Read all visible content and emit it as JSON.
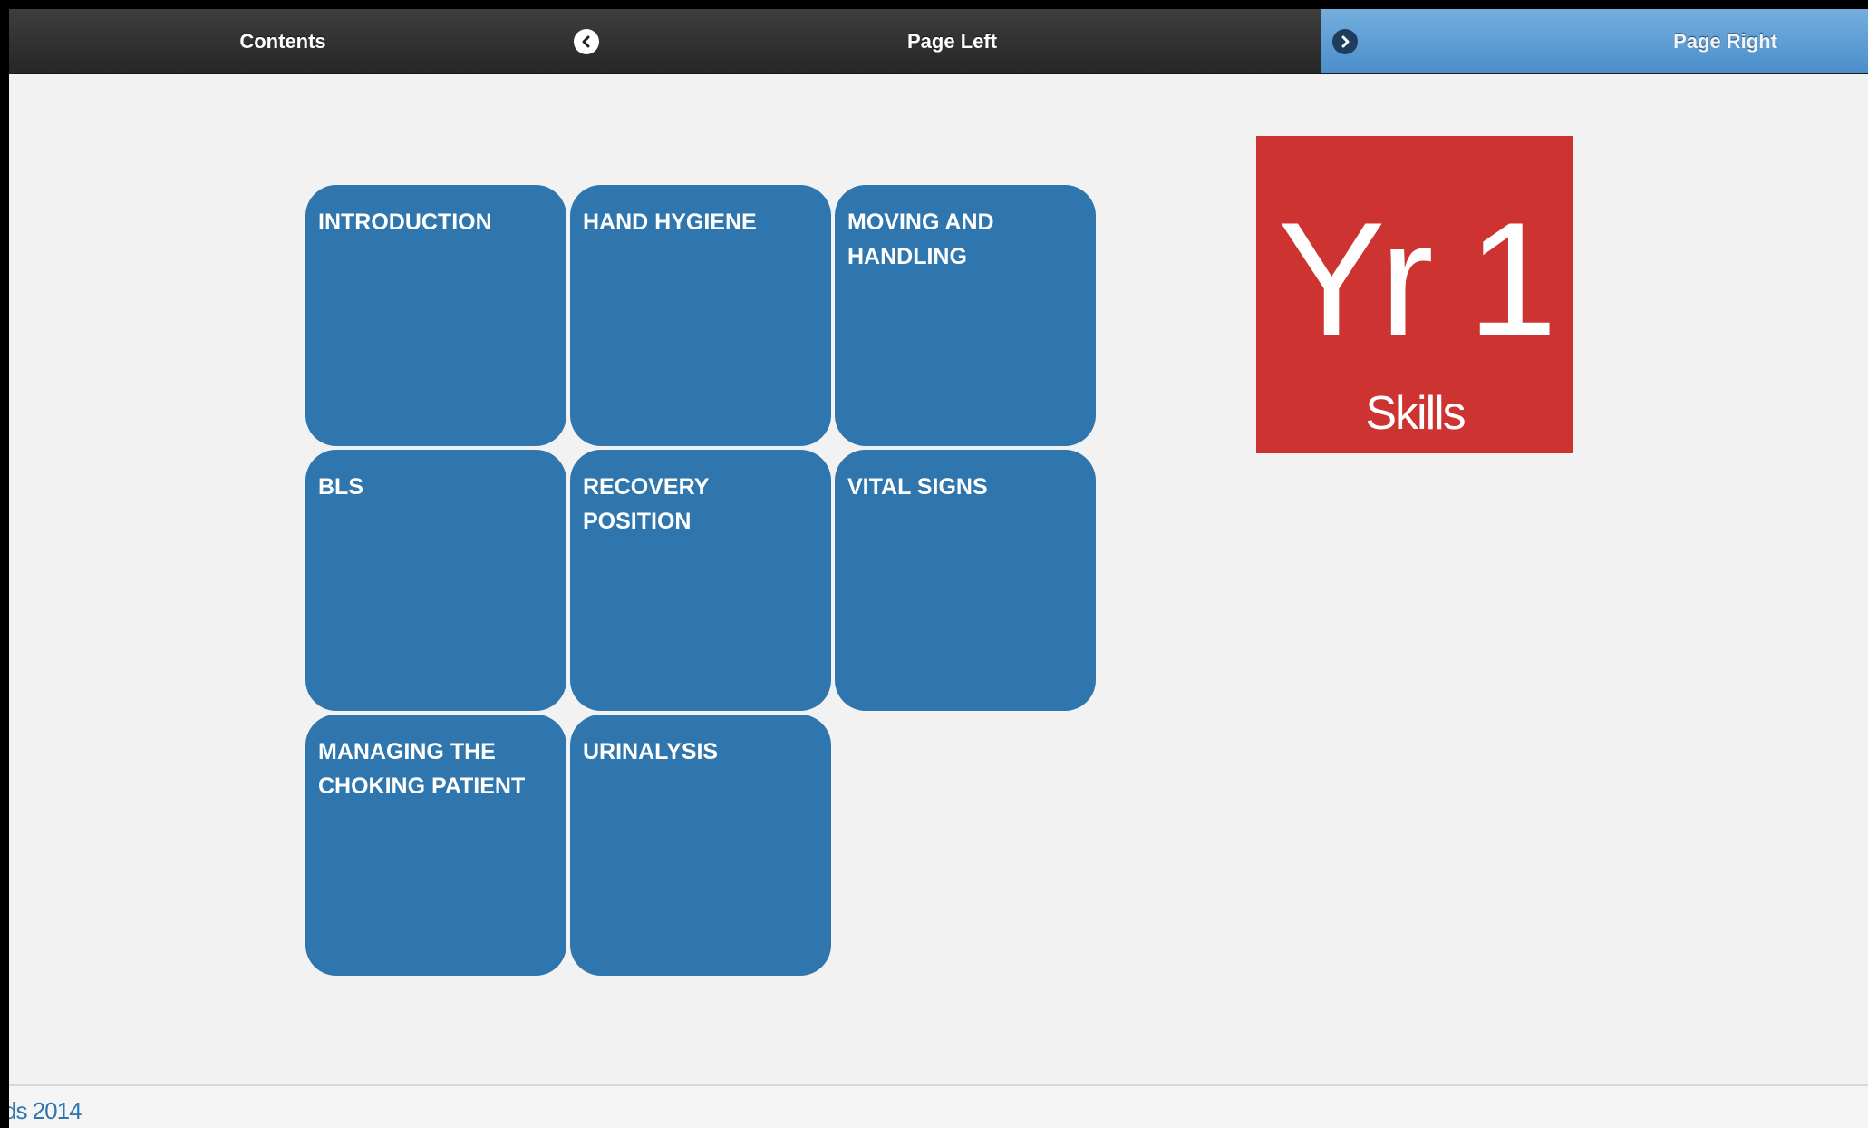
{
  "navbar": {
    "contents_label": "Contents",
    "page_left_label": "Page Left",
    "page_right_label": "Page Right"
  },
  "tiles": [
    {
      "title": "INTRODUCTION"
    },
    {
      "title": "HAND HYGIENE"
    },
    {
      "title": "MOVING AND HANDLING"
    },
    {
      "title": "BLS"
    },
    {
      "title": "RECOVERY POSITION"
    },
    {
      "title": "VITAL SIGNS"
    },
    {
      "title": "MANAGING THE CHOKING PATIENT"
    },
    {
      "title": "URINALYSIS"
    }
  ],
  "badge": {
    "main_text": "Yr 1",
    "sub_text": "Skills",
    "color": "#cc3331"
  },
  "footer": {
    "text": "ds 2014"
  },
  "colors": {
    "tile": "#2e76ad",
    "nav_active": "#5a9bd5",
    "nav_dark": "#2f2f2f"
  }
}
